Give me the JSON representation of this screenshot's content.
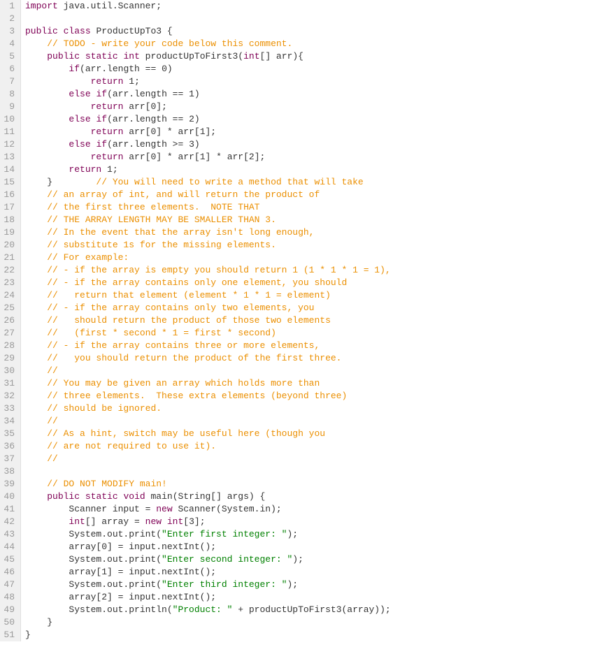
{
  "lines": [
    {
      "n": 1,
      "segments": [
        {
          "t": "import",
          "c": "kw"
        },
        {
          "t": " java.util.Scanner;",
          "c": "pln"
        }
      ]
    },
    {
      "n": 2,
      "segments": [
        {
          "t": "",
          "c": "pln"
        }
      ]
    },
    {
      "n": 3,
      "segments": [
        {
          "t": "public",
          "c": "kw"
        },
        {
          "t": " ",
          "c": "pln"
        },
        {
          "t": "class",
          "c": "kw"
        },
        {
          "t": " ProductUpTo3 {",
          "c": "cls"
        }
      ]
    },
    {
      "n": 4,
      "segments": [
        {
          "t": "    ",
          "c": "pln"
        },
        {
          "t": "// TODO - write your code below this comment.",
          "c": "cm"
        }
      ]
    },
    {
      "n": 5,
      "segments": [
        {
          "t": "    ",
          "c": "pln"
        },
        {
          "t": "public",
          "c": "kw"
        },
        {
          "t": " ",
          "c": "pln"
        },
        {
          "t": "static",
          "c": "kw"
        },
        {
          "t": " ",
          "c": "pln"
        },
        {
          "t": "int",
          "c": "kw"
        },
        {
          "t": " productUpToFirst3(",
          "c": "pln"
        },
        {
          "t": "int",
          "c": "kw"
        },
        {
          "t": "[] arr){",
          "c": "pln"
        }
      ]
    },
    {
      "n": 6,
      "segments": [
        {
          "t": "        ",
          "c": "pln"
        },
        {
          "t": "if",
          "c": "kw"
        },
        {
          "t": "(arr.length == ",
          "c": "pln"
        },
        {
          "t": "0",
          "c": "num"
        },
        {
          "t": ")",
          "c": "pln"
        }
      ]
    },
    {
      "n": 7,
      "segments": [
        {
          "t": "            ",
          "c": "pln"
        },
        {
          "t": "return",
          "c": "kw"
        },
        {
          "t": " ",
          "c": "pln"
        },
        {
          "t": "1",
          "c": "num"
        },
        {
          "t": ";",
          "c": "pln"
        }
      ]
    },
    {
      "n": 8,
      "segments": [
        {
          "t": "        ",
          "c": "pln"
        },
        {
          "t": "else",
          "c": "kw"
        },
        {
          "t": " ",
          "c": "pln"
        },
        {
          "t": "if",
          "c": "kw"
        },
        {
          "t": "(arr.length == ",
          "c": "pln"
        },
        {
          "t": "1",
          "c": "num"
        },
        {
          "t": ")",
          "c": "pln"
        }
      ]
    },
    {
      "n": 9,
      "segments": [
        {
          "t": "            ",
          "c": "pln"
        },
        {
          "t": "return",
          "c": "kw"
        },
        {
          "t": " arr[",
          "c": "pln"
        },
        {
          "t": "0",
          "c": "num"
        },
        {
          "t": "];",
          "c": "pln"
        }
      ]
    },
    {
      "n": 10,
      "segments": [
        {
          "t": "        ",
          "c": "pln"
        },
        {
          "t": "else",
          "c": "kw"
        },
        {
          "t": " ",
          "c": "pln"
        },
        {
          "t": "if",
          "c": "kw"
        },
        {
          "t": "(arr.length == ",
          "c": "pln"
        },
        {
          "t": "2",
          "c": "num"
        },
        {
          "t": ")",
          "c": "pln"
        }
      ]
    },
    {
      "n": 11,
      "segments": [
        {
          "t": "            ",
          "c": "pln"
        },
        {
          "t": "return",
          "c": "kw"
        },
        {
          "t": " arr[",
          "c": "pln"
        },
        {
          "t": "0",
          "c": "num"
        },
        {
          "t": "] * arr[",
          "c": "pln"
        },
        {
          "t": "1",
          "c": "num"
        },
        {
          "t": "];",
          "c": "pln"
        }
      ]
    },
    {
      "n": 12,
      "segments": [
        {
          "t": "        ",
          "c": "pln"
        },
        {
          "t": "else",
          "c": "kw"
        },
        {
          "t": " ",
          "c": "pln"
        },
        {
          "t": "if",
          "c": "kw"
        },
        {
          "t": "(arr.length >= ",
          "c": "pln"
        },
        {
          "t": "3",
          "c": "num"
        },
        {
          "t": ")",
          "c": "pln"
        }
      ]
    },
    {
      "n": 13,
      "segments": [
        {
          "t": "            ",
          "c": "pln"
        },
        {
          "t": "return",
          "c": "kw"
        },
        {
          "t": " arr[",
          "c": "pln"
        },
        {
          "t": "0",
          "c": "num"
        },
        {
          "t": "] * arr[",
          "c": "pln"
        },
        {
          "t": "1",
          "c": "num"
        },
        {
          "t": "] * arr[",
          "c": "pln"
        },
        {
          "t": "2",
          "c": "num"
        },
        {
          "t": "];",
          "c": "pln"
        }
      ]
    },
    {
      "n": 14,
      "segments": [
        {
          "t": "        ",
          "c": "pln"
        },
        {
          "t": "return",
          "c": "kw"
        },
        {
          "t": " ",
          "c": "pln"
        },
        {
          "t": "1",
          "c": "num"
        },
        {
          "t": ";",
          "c": "pln"
        }
      ]
    },
    {
      "n": 15,
      "segments": [
        {
          "t": "    }        ",
          "c": "pln"
        },
        {
          "t": "// You will need to write a method that will take",
          "c": "cm"
        }
      ]
    },
    {
      "n": 16,
      "segments": [
        {
          "t": "    ",
          "c": "pln"
        },
        {
          "t": "// an array of int, and will return the product of",
          "c": "cm"
        }
      ]
    },
    {
      "n": 17,
      "segments": [
        {
          "t": "    ",
          "c": "pln"
        },
        {
          "t": "// the first three elements.  NOTE THAT",
          "c": "cm"
        }
      ]
    },
    {
      "n": 18,
      "segments": [
        {
          "t": "    ",
          "c": "pln"
        },
        {
          "t": "// THE ARRAY LENGTH MAY BE SMALLER THAN 3.",
          "c": "cm"
        }
      ]
    },
    {
      "n": 19,
      "segments": [
        {
          "t": "    ",
          "c": "pln"
        },
        {
          "t": "// In the event that the array isn't long enough,",
          "c": "cm"
        }
      ]
    },
    {
      "n": 20,
      "segments": [
        {
          "t": "    ",
          "c": "pln"
        },
        {
          "t": "// substitute 1s for the missing elements.",
          "c": "cm"
        }
      ]
    },
    {
      "n": 21,
      "segments": [
        {
          "t": "    ",
          "c": "pln"
        },
        {
          "t": "// For example:",
          "c": "cm"
        }
      ]
    },
    {
      "n": 22,
      "segments": [
        {
          "t": "    ",
          "c": "pln"
        },
        {
          "t": "// - if the array is empty you should return 1 (1 * 1 * 1 = 1),",
          "c": "cm"
        }
      ]
    },
    {
      "n": 23,
      "segments": [
        {
          "t": "    ",
          "c": "pln"
        },
        {
          "t": "// - if the array contains only one element, you should",
          "c": "cm"
        }
      ]
    },
    {
      "n": 24,
      "segments": [
        {
          "t": "    ",
          "c": "pln"
        },
        {
          "t": "//   return that element (element * 1 * 1 = element)",
          "c": "cm"
        }
      ]
    },
    {
      "n": 25,
      "segments": [
        {
          "t": "    ",
          "c": "pln"
        },
        {
          "t": "// - if the array contains only two elements, you",
          "c": "cm"
        }
      ]
    },
    {
      "n": 26,
      "segments": [
        {
          "t": "    ",
          "c": "pln"
        },
        {
          "t": "//   should return the product of those two elements",
          "c": "cm"
        }
      ]
    },
    {
      "n": 27,
      "segments": [
        {
          "t": "    ",
          "c": "pln"
        },
        {
          "t": "//   (first * second * 1 = first * second)",
          "c": "cm"
        }
      ]
    },
    {
      "n": 28,
      "segments": [
        {
          "t": "    ",
          "c": "pln"
        },
        {
          "t": "// - if the array contains three or more elements,",
          "c": "cm"
        }
      ]
    },
    {
      "n": 29,
      "segments": [
        {
          "t": "    ",
          "c": "pln"
        },
        {
          "t": "//   you should return the product of the first three.",
          "c": "cm"
        }
      ]
    },
    {
      "n": 30,
      "segments": [
        {
          "t": "    ",
          "c": "pln"
        },
        {
          "t": "//",
          "c": "cm"
        }
      ]
    },
    {
      "n": 31,
      "segments": [
        {
          "t": "    ",
          "c": "pln"
        },
        {
          "t": "// You may be given an array which holds more than",
          "c": "cm"
        }
      ]
    },
    {
      "n": 32,
      "segments": [
        {
          "t": "    ",
          "c": "pln"
        },
        {
          "t": "// three elements.  These extra elements (beyond three)",
          "c": "cm"
        }
      ]
    },
    {
      "n": 33,
      "segments": [
        {
          "t": "    ",
          "c": "pln"
        },
        {
          "t": "// should be ignored.",
          "c": "cm"
        }
      ]
    },
    {
      "n": 34,
      "segments": [
        {
          "t": "    ",
          "c": "pln"
        },
        {
          "t": "//",
          "c": "cm"
        }
      ]
    },
    {
      "n": 35,
      "segments": [
        {
          "t": "    ",
          "c": "pln"
        },
        {
          "t": "// As a hint, switch may be useful here (though you",
          "c": "cm"
        }
      ]
    },
    {
      "n": 36,
      "segments": [
        {
          "t": "    ",
          "c": "pln"
        },
        {
          "t": "// are not required to use it).",
          "c": "cm"
        }
      ]
    },
    {
      "n": 37,
      "segments": [
        {
          "t": "    ",
          "c": "pln"
        },
        {
          "t": "//",
          "c": "cm"
        }
      ]
    },
    {
      "n": 38,
      "segments": [
        {
          "t": "",
          "c": "pln"
        }
      ]
    },
    {
      "n": 39,
      "segments": [
        {
          "t": "    ",
          "c": "pln"
        },
        {
          "t": "// DO NOT MODIFY main!",
          "c": "cm"
        }
      ]
    },
    {
      "n": 40,
      "segments": [
        {
          "t": "    ",
          "c": "pln"
        },
        {
          "t": "public",
          "c": "kw"
        },
        {
          "t": " ",
          "c": "pln"
        },
        {
          "t": "static",
          "c": "kw"
        },
        {
          "t": " ",
          "c": "pln"
        },
        {
          "t": "void",
          "c": "kw"
        },
        {
          "t": " main(String[] args) {",
          "c": "pln"
        }
      ]
    },
    {
      "n": 41,
      "segments": [
        {
          "t": "        Scanner input = ",
          "c": "pln"
        },
        {
          "t": "new",
          "c": "kw"
        },
        {
          "t": " Scanner(System.in);",
          "c": "pln"
        }
      ]
    },
    {
      "n": 42,
      "segments": [
        {
          "t": "        ",
          "c": "pln"
        },
        {
          "t": "int",
          "c": "kw"
        },
        {
          "t": "[] array = ",
          "c": "pln"
        },
        {
          "t": "new",
          "c": "kw"
        },
        {
          "t": " ",
          "c": "pln"
        },
        {
          "t": "int",
          "c": "kw"
        },
        {
          "t": "[",
          "c": "pln"
        },
        {
          "t": "3",
          "c": "num"
        },
        {
          "t": "];",
          "c": "pln"
        }
      ]
    },
    {
      "n": 43,
      "segments": [
        {
          "t": "        System.out.print(",
          "c": "pln"
        },
        {
          "t": "\"Enter first integer: \"",
          "c": "str"
        },
        {
          "t": ");",
          "c": "pln"
        }
      ]
    },
    {
      "n": 44,
      "segments": [
        {
          "t": "        array[",
          "c": "pln"
        },
        {
          "t": "0",
          "c": "num"
        },
        {
          "t": "] = input.nextInt();",
          "c": "pln"
        }
      ]
    },
    {
      "n": 45,
      "segments": [
        {
          "t": "        System.out.print(",
          "c": "pln"
        },
        {
          "t": "\"Enter second integer: \"",
          "c": "str"
        },
        {
          "t": ");",
          "c": "pln"
        }
      ]
    },
    {
      "n": 46,
      "segments": [
        {
          "t": "        array[",
          "c": "pln"
        },
        {
          "t": "1",
          "c": "num"
        },
        {
          "t": "] = input.nextInt();",
          "c": "pln"
        }
      ]
    },
    {
      "n": 47,
      "segments": [
        {
          "t": "        System.out.print(",
          "c": "pln"
        },
        {
          "t": "\"Enter third integer: \"",
          "c": "str"
        },
        {
          "t": ");",
          "c": "pln"
        }
      ]
    },
    {
      "n": 48,
      "segments": [
        {
          "t": "        array[",
          "c": "pln"
        },
        {
          "t": "2",
          "c": "num"
        },
        {
          "t": "] = input.nextInt();",
          "c": "pln"
        }
      ]
    },
    {
      "n": 49,
      "segments": [
        {
          "t": "        System.out.println(",
          "c": "pln"
        },
        {
          "t": "\"Product: \"",
          "c": "str"
        },
        {
          "t": " + productUpToFirst3(array));",
          "c": "pln"
        }
      ]
    },
    {
      "n": 50,
      "segments": [
        {
          "t": "    }",
          "c": "pln"
        }
      ]
    },
    {
      "n": 51,
      "segments": [
        {
          "t": "}",
          "c": "pln"
        }
      ]
    }
  ]
}
